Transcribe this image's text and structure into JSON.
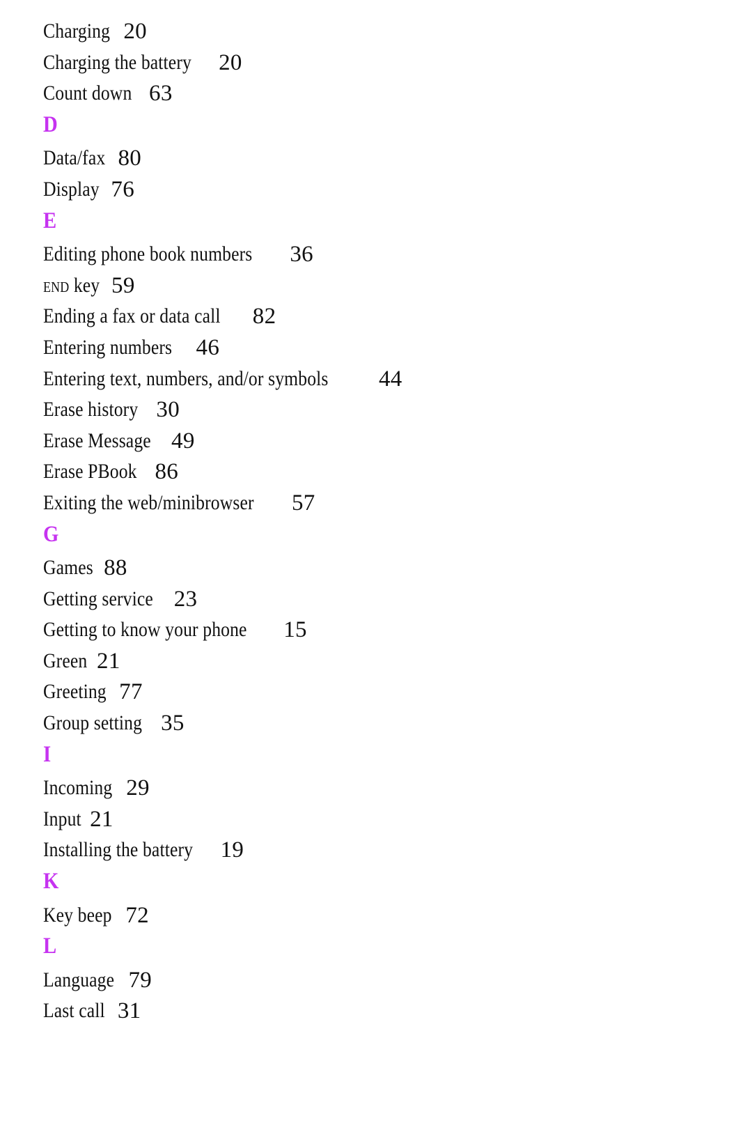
{
  "document": {
    "type": "book-index",
    "page_background": "#ffffff",
    "text_color": "#111111",
    "section_letter_color": "#c633f0"
  },
  "index": {
    "blocks": [
      {
        "kind": "entries",
        "entries": [
          {
            "label": "Charging",
            "page": "20"
          },
          {
            "label": "Charging the battery",
            "page": "20"
          },
          {
            "label": "Count down",
            "page": "63"
          }
        ]
      },
      {
        "kind": "section",
        "letter": "D",
        "entries": [
          {
            "label": "Data/fax",
            "page": "80"
          },
          {
            "label": "Display",
            "page": "76"
          }
        ]
      },
      {
        "kind": "section",
        "letter": "E",
        "entries": [
          {
            "label": "Editing phone book numbers",
            "page": "36"
          },
          {
            "label": "END key",
            "page": "59",
            "smallcaps_prefix": "END",
            "rest": " key"
          },
          {
            "label": "Ending a fax or data call",
            "page": "82"
          },
          {
            "label": "Entering numbers",
            "page": "46"
          },
          {
            "label": "Entering text, numbers, and/or symbols",
            "page": "44"
          },
          {
            "label": "Erase history",
            "page": "30"
          },
          {
            "label": "Erase Message",
            "page": "49"
          },
          {
            "label": "Erase PBook",
            "page": "86"
          },
          {
            "label": "Exiting the web/minibrowser",
            "page": "57"
          }
        ]
      },
      {
        "kind": "section",
        "letter": "G",
        "entries": [
          {
            "label": "Games",
            "page": "88"
          },
          {
            "label": "Getting service",
            "page": "23"
          },
          {
            "label": "Getting to know your phone",
            "page": "15"
          },
          {
            "label": "Green",
            "page": "21"
          },
          {
            "label": "Greeting",
            "page": "77"
          },
          {
            "label": "Group setting",
            "page": "35"
          }
        ]
      },
      {
        "kind": "section",
        "letter": "I",
        "entries": [
          {
            "label": "Incoming",
            "page": "29"
          },
          {
            "label": "Input",
            "page": "21"
          },
          {
            "label": "Installing the battery",
            "page": "19"
          }
        ]
      },
      {
        "kind": "section",
        "letter": "K",
        "entries": [
          {
            "label": "Key beep",
            "page": "72"
          }
        ]
      },
      {
        "kind": "section",
        "letter": "L",
        "entries": [
          {
            "label": "Language",
            "page": "79"
          },
          {
            "label": "Last call",
            "page": "31"
          }
        ]
      }
    ]
  }
}
